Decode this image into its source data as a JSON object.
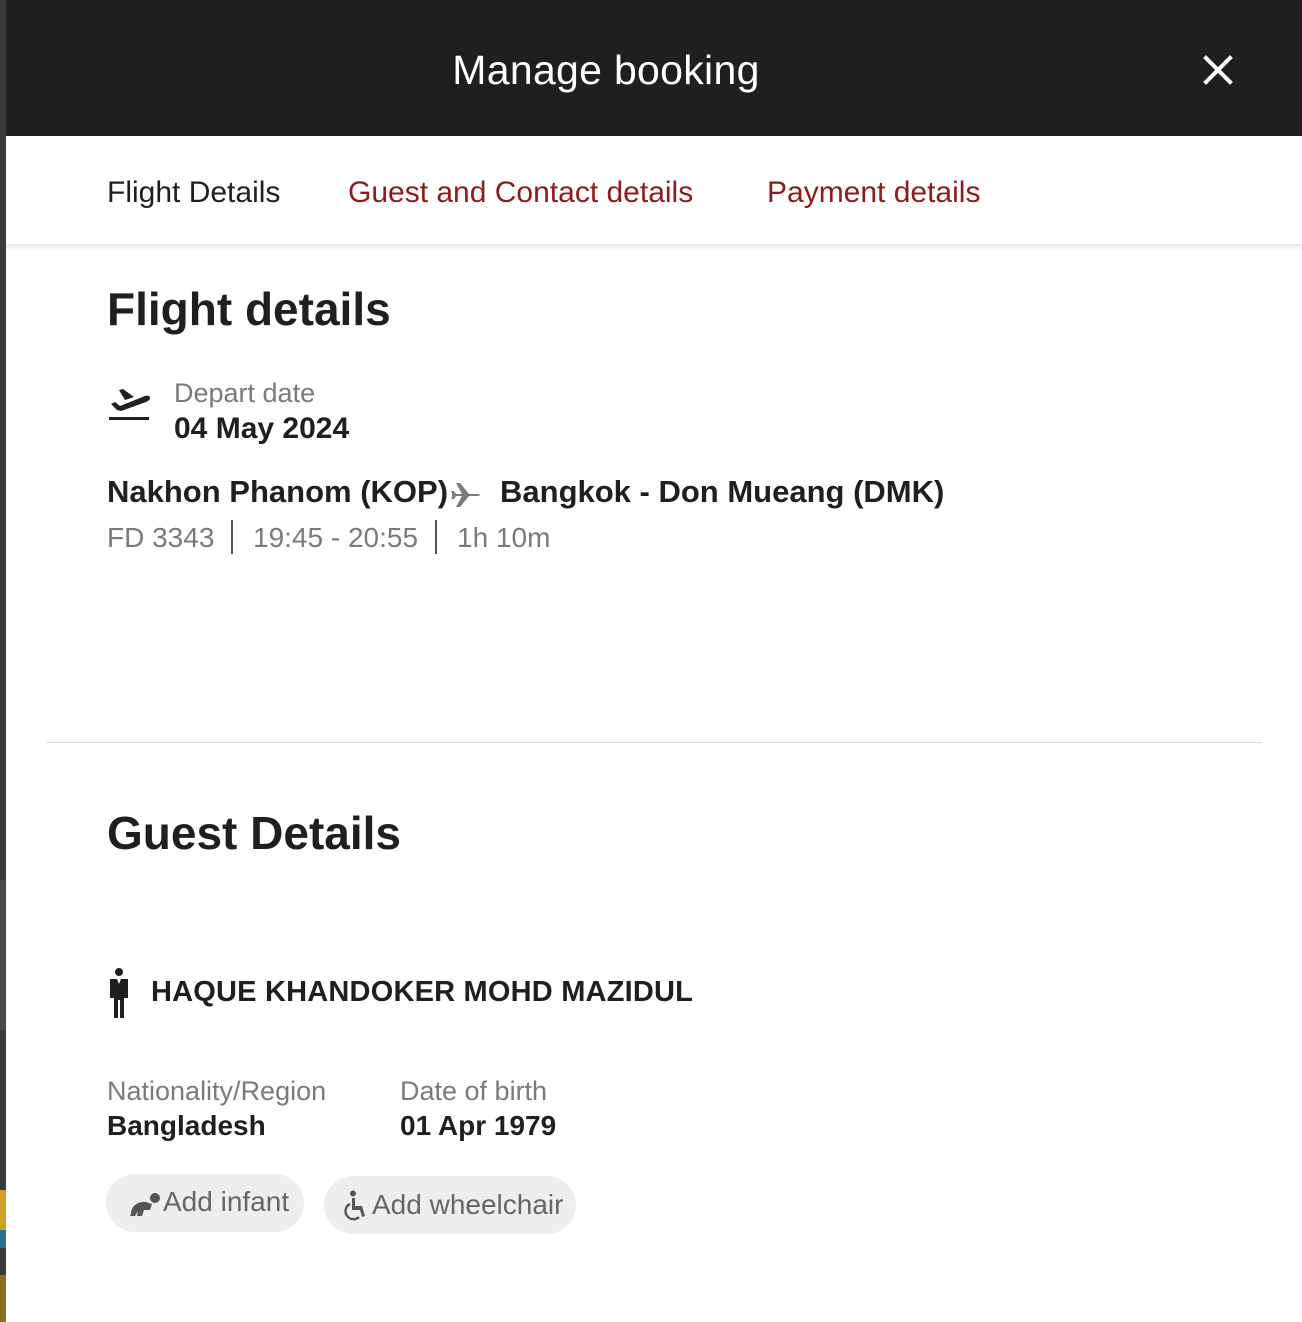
{
  "header": {
    "title": "Manage booking",
    "close_icon": "close-icon"
  },
  "tabs": [
    {
      "label": "Flight Details",
      "active": true
    },
    {
      "label": "Guest and Contact details",
      "active": false
    },
    {
      "label": "Payment details",
      "active": false
    }
  ],
  "flight": {
    "section_title": "Flight details",
    "depart_label": "Depart date",
    "depart_date": "04 May 2024",
    "origin": "Nakhon Phanom (KOP)",
    "destination": "Bangkok - Don Mueang (DMK)",
    "flight_number": "FD 3343",
    "time": "19:45 - 20:55",
    "duration": "1h 10m"
  },
  "guest": {
    "section_title": "Guest Details",
    "name": "HAQUE KHANDOKER MOHD MAZIDUL",
    "nationality_label": "Nationality/Region",
    "nationality": "Bangladesh",
    "dob_label": "Date of birth",
    "dob": "01 Apr 1979",
    "add_infant": "Add infant",
    "add_wheelchair": "Add wheelchair"
  },
  "colors": {
    "header_bg": "#1f1f1f",
    "link_red": "#8e1b1b",
    "muted_text": "#7a7a7a",
    "pill_bg": "#eeeeee"
  }
}
